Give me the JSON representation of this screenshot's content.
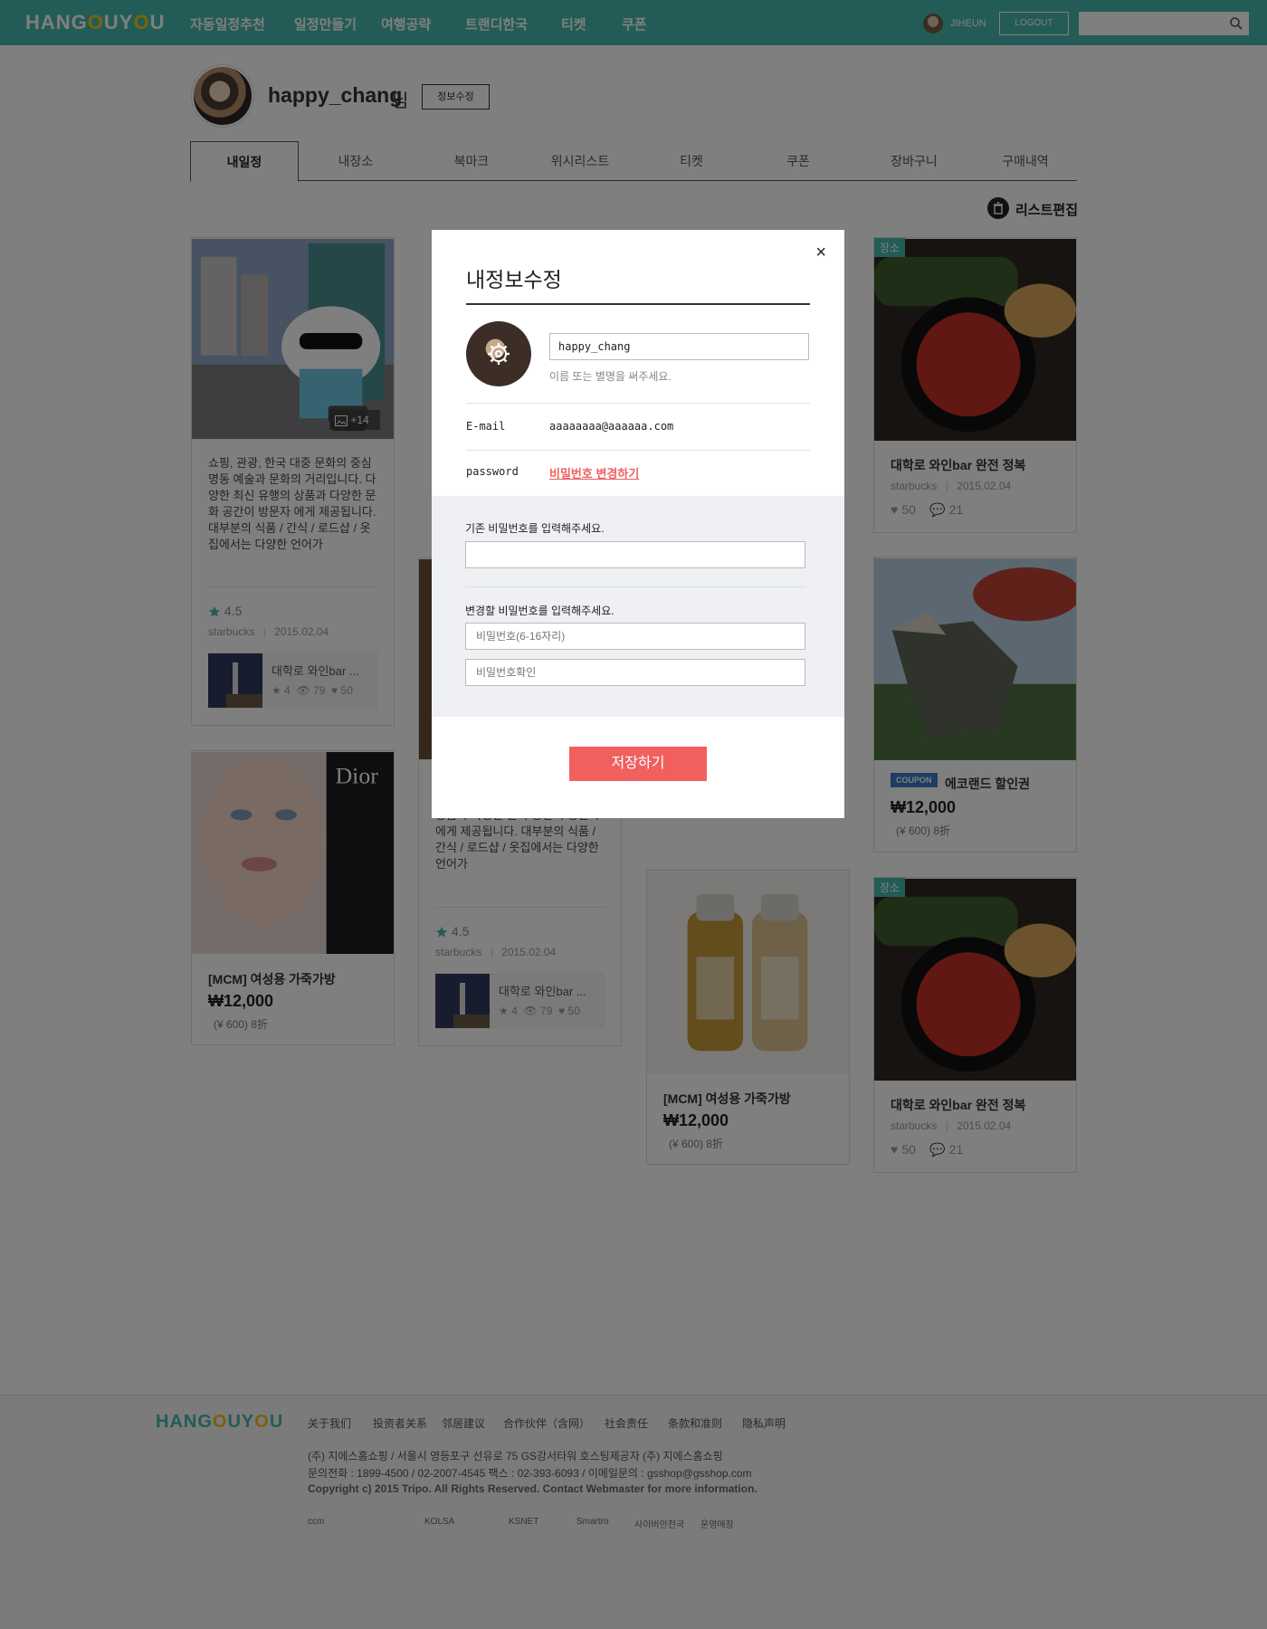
{
  "brand": {
    "logo_pre": "HANG",
    "logo_o1": "O",
    "logo_mid": "UY",
    "logo_o2": "O",
    "logo_post": "U"
  },
  "nav": [
    "자동일정추천",
    "일정만들기",
    "여행공략",
    "트랜디한국",
    "티켓",
    "쿠폰"
  ],
  "header": {
    "user": "JIHEUN",
    "logout": "LOGOUT",
    "search_placeholder": ""
  },
  "profile": {
    "username": "happy_chang",
    "suffix": "님",
    "edit_button": "정보수정"
  },
  "tabs": [
    "내일정",
    "내장소",
    "북마크",
    "위시리스트",
    "티켓",
    "쿠폰",
    "장바구니",
    "구매내역"
  ],
  "active_tab": "내일정",
  "list_edit": "리스트편집",
  "cards": {
    "c1": {
      "photo_count": "+14",
      "desc": "쇼핑, 관광, 한국 대중 문화의 중심 명동 예술과 문화의 거리입니다. 다양한 최신 유행의 상품과 다양한 문화 공간이 방문자 에게 제공됩니다. 대부분의 식품 / 간식 / 로드샵 / 옷집에서는 다양한 언어가",
      "rating": "4.5",
      "author": "starbucks",
      "date": "2015.02.04",
      "sub_title": "대학로 와인bar ...",
      "sub_stars": "4",
      "sub_views": "79",
      "sub_likes": "50"
    },
    "c2": {
      "title": "[MCM] 여성용 가죽가방",
      "price": "₩12,000",
      "subprice": "(¥ 600) 8折"
    },
    "c3": {
      "desc": "상품과 다양한 문화 공간이 방문자 에게 제공됩니다. 대부분의 식품 / 간식 / 로드샵 / 옷집에서는 다양한 언어가",
      "rating": "4.5",
      "author": "starbucks",
      "date": "2015.02.04",
      "sub_title": "대학로 와인bar ...",
      "sub_stars": "4",
      "sub_views": "79",
      "sub_likes": "50"
    },
    "c4": {
      "title": "[MCM] 여성용 가죽가방",
      "price": "₩12,000",
      "subprice": "(¥ 600) 8折"
    },
    "c5": {
      "tag": "장소",
      "title": "대학로 와인bar 완전 정복",
      "author": "starbucks",
      "date": "2015.02.04",
      "likes": "50",
      "comments": "21"
    },
    "c6": {
      "coupon_tag": "COUPON",
      "title": "에코랜드 할인권",
      "price": "₩12,000",
      "subprice": "(¥ 600) 8折"
    },
    "c7": {
      "tag": "장소",
      "title": "대학로 와인bar 완전 정복",
      "author": "starbucks",
      "date": "2015.02.04",
      "likes": "50",
      "comments": "21"
    }
  },
  "modal": {
    "close": "×",
    "title": "내정보수정",
    "name_value": "happy_chang",
    "name_hint": "이름 또는 별명을 써주세요.",
    "email_label": "E-mail",
    "email_value": "aaaaaaaa@aaaaaa.com",
    "password_label": "password",
    "password_change": "비밀번호 변경하기",
    "current_pw_label": "기존 비밀번호를 입력해주세요.",
    "new_pw_label": "변경할 비밀번호를 입력해주세요.",
    "new_pw_placeholder": "비밀번호(6-16자리)",
    "confirm_pw_placeholder": "비밀번호확인",
    "save": "저장하기"
  },
  "footer": {
    "links": [
      "关于我们",
      "投资者关系",
      "邻居建议",
      "合作伙伴（含网）",
      "社会责任",
      "条款和准则",
      "隐私声明"
    ],
    "line1": "(주) 지에스홈쇼핑  / 서울시 영등포구 선유로 75 GS강서타워 호스팅제공자 (주) 지에스홈쇼핑",
    "line2": "문의전화 : 1899-4500 / 02-2007-4545 팩스 : 02-393-6093 / 이메일문의 : gsshop@gsshop.com",
    "line3": "Copyright c) 2015 Tripo. All Rights Reserved. Contact Webmaster for more information.",
    "badges": [
      "ccm",
      "KOLSA",
      "KSNET",
      "Smartro",
      "사이버안전국",
      "운영매장"
    ]
  },
  "colors": {
    "accent": "#47b8ad",
    "save": "#f25f5f",
    "logo_o": "#f3c51b"
  }
}
